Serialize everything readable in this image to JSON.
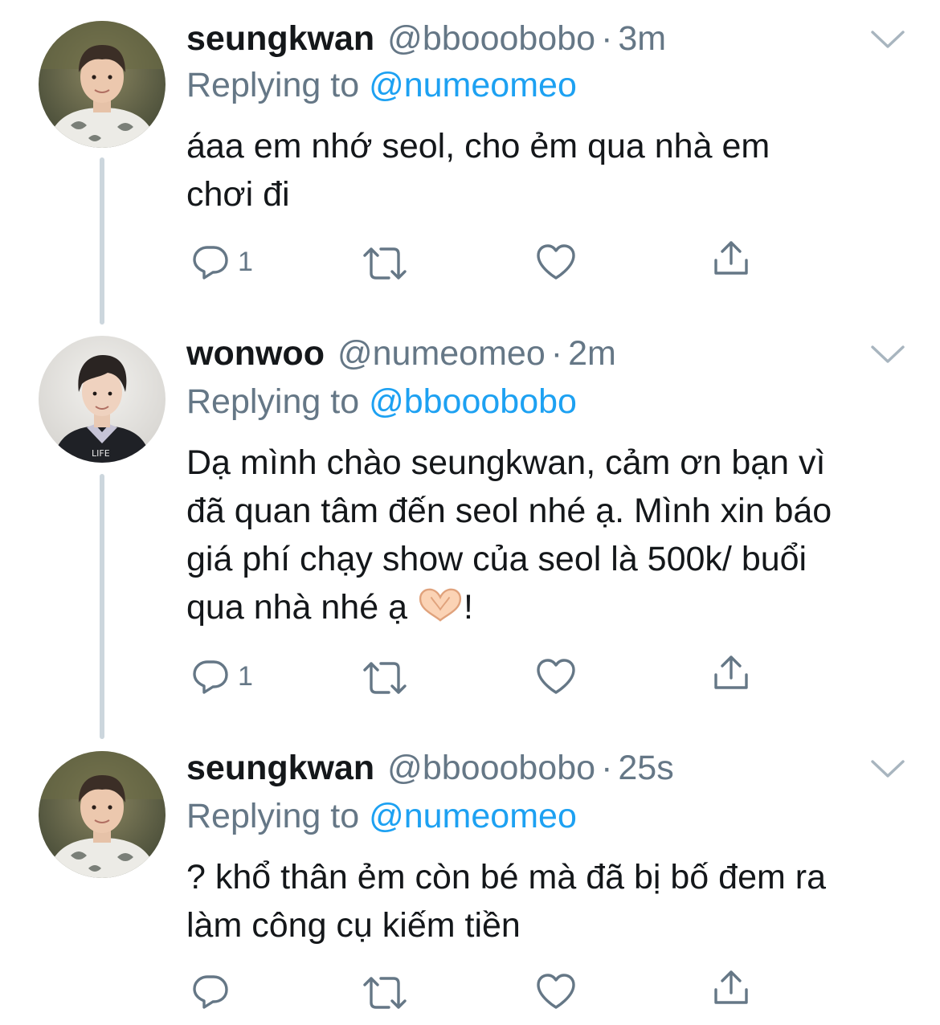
{
  "tweets": [
    {
      "name": "seungkwan",
      "handle": "@bbooobobo",
      "dot": "·",
      "time": "3m",
      "replying_prefix": "Replying to ",
      "replying_to": "@numeomeo",
      "text_lines": [
        "áaa em nhớ seol, cho ẻm qua nhà em",
        "chơi đi"
      ],
      "reply_count": "1",
      "avatar": "avatar-seungkwan"
    },
    {
      "name": "wonwoo",
      "handle": "@numeomeo",
      "dot": "·",
      "time": "2m",
      "replying_prefix": "Replying to ",
      "replying_to": "@bbooobobo",
      "text_lines": [
        "Dạ mình chào seungkwan, cảm ơn bạn vì",
        "đã quan tâm đến seol nhé ạ. Mình xin báo",
        "giá phí chạy show của seol là 500k/ buổi",
        "qua nhà nhé ạ"
      ],
      "text_suffix": "!",
      "emoji": "heart-hands-icon",
      "reply_count": "1",
      "avatar": "avatar-wonwoo"
    },
    {
      "name": "seungkwan",
      "handle": "@bbooobobo",
      "dot": "·",
      "time": "25s",
      "replying_prefix": "Replying to ",
      "replying_to": "@numeomeo",
      "text_lines": [
        "? khổ thân ẻm còn bé mà đã bị bố đem ra",
        "làm công cụ kiếm tiền"
      ],
      "reply_count": "",
      "avatar": "avatar-seungkwan"
    }
  ],
  "colors": {
    "text": "#14171a",
    "secondary": "#657786",
    "link": "#1da1f2",
    "thread_line": "#ccd6dd"
  },
  "icons": [
    "reply-icon",
    "retweet-icon",
    "like-icon",
    "share-icon",
    "chevron-down-icon"
  ]
}
